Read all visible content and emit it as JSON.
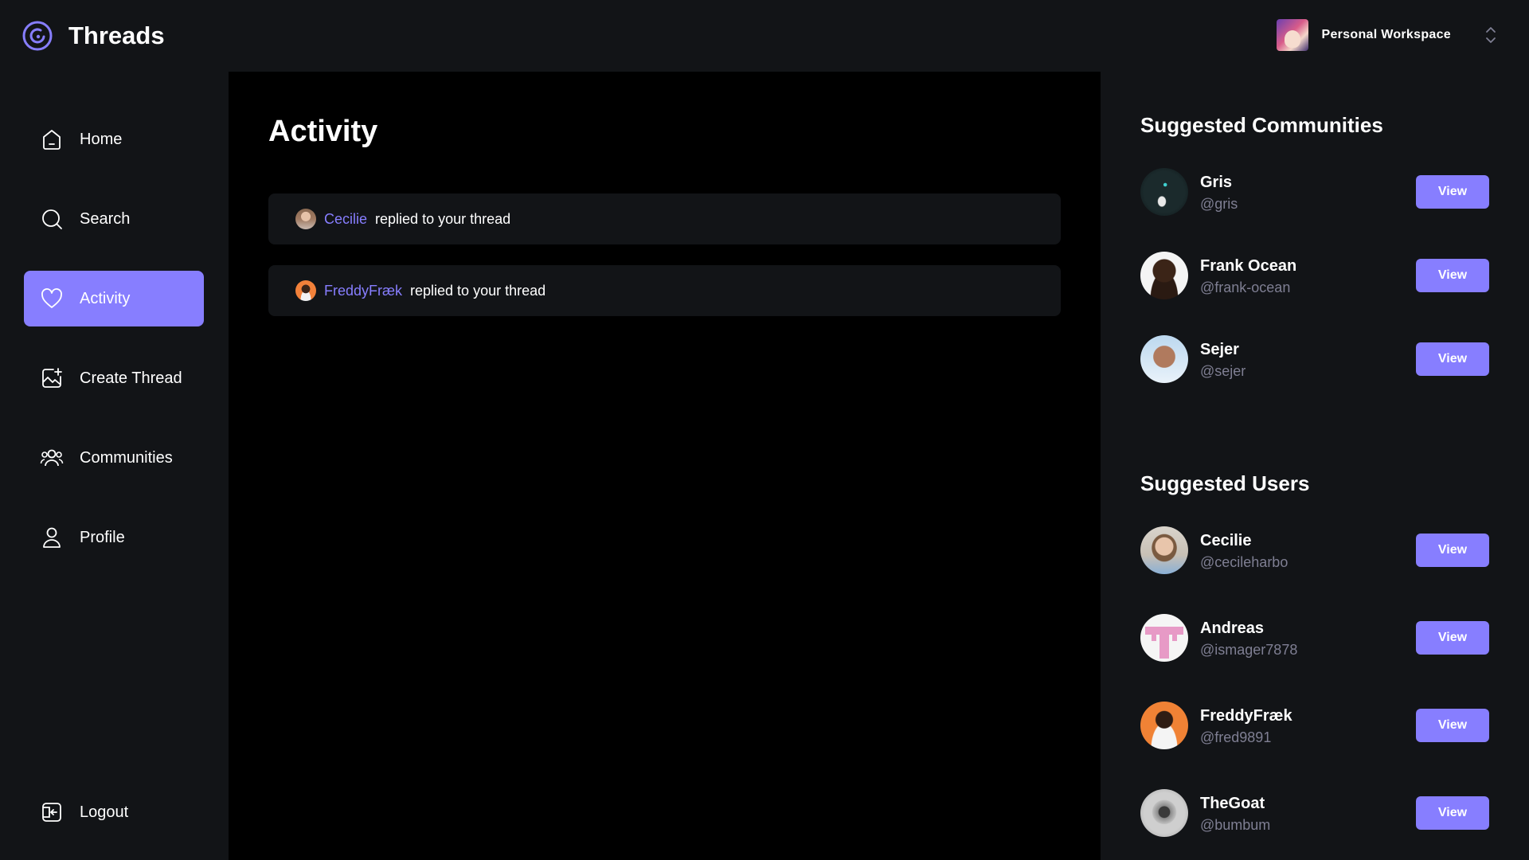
{
  "app": {
    "name": "Threads",
    "logo_icon": "threads-logo-icon"
  },
  "workspace": {
    "name": "Personal Workspace",
    "chevron_icon": "chevron-up-down-icon"
  },
  "nav": {
    "items": [
      {
        "label": "Home",
        "icon": "home-icon",
        "active": false
      },
      {
        "label": "Search",
        "icon": "search-icon",
        "active": false
      },
      {
        "label": "Activity",
        "icon": "heart-icon",
        "active": true
      },
      {
        "label": "Create Thread",
        "icon": "create-thread-icon",
        "active": false
      },
      {
        "label": "Communities",
        "icon": "communities-icon",
        "active": false
      },
      {
        "label": "Profile",
        "icon": "profile-icon",
        "active": false
      }
    ],
    "logout": {
      "label": "Logout",
      "icon": "logout-icon"
    }
  },
  "main": {
    "title": "Activity",
    "activities": [
      {
        "user": "Cecilie",
        "text": "replied to your thread"
      },
      {
        "user": "FreddyFræk",
        "text": "replied to your thread"
      }
    ]
  },
  "right": {
    "communities_title": "Suggested Communities",
    "communities": [
      {
        "name": "Gris",
        "handle": "@gris",
        "button": "View"
      },
      {
        "name": "Frank Ocean",
        "handle": "@frank-ocean",
        "button": "View"
      },
      {
        "name": "Sejer",
        "handle": "@sejer",
        "button": "View"
      }
    ],
    "users_title": "Suggested Users",
    "users": [
      {
        "name": "Cecilie",
        "handle": "@cecileharbo",
        "button": "View"
      },
      {
        "name": "Andreas",
        "handle": "@ismager7878",
        "button": "View"
      },
      {
        "name": "FreddyFræk",
        "handle": "@fred9891",
        "button": "View"
      },
      {
        "name": "TheGoat",
        "handle": "@bumbum",
        "button": "View"
      }
    ]
  },
  "colors": {
    "accent": "#877eff",
    "background": "#121417",
    "main_background": "#000000",
    "handle_gray": "#7f7f93"
  }
}
